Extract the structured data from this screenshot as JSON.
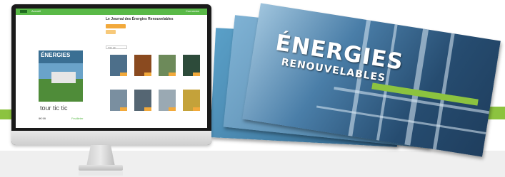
{
  "screen": {
    "topbar_left": "Accueil",
    "topbar_right": "Connexion",
    "site_title": "Le Journal des Énergies Renouvelables",
    "filter_label": "Trier par",
    "magazine_logo": "tour tic tic",
    "magazine_price": "9€ 99",
    "magazine_link": "Feuilleter"
  },
  "cover": {
    "title_line1": "ÉNERGIES",
    "title_line2": "RENOUVELABLES"
  },
  "colors": {
    "accent_green": "#8cc33f",
    "topbar_green": "#59b947",
    "button_orange": "#f2a93b"
  }
}
